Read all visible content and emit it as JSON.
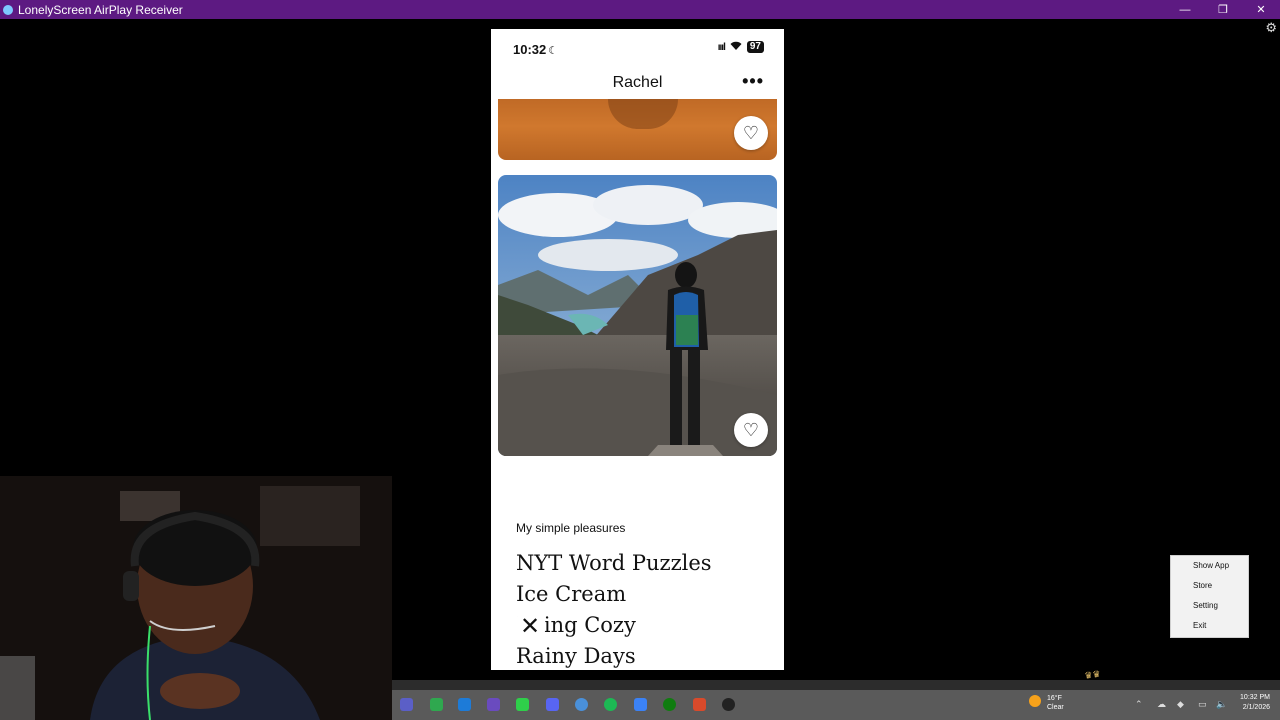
{
  "window": {
    "title": "LonelyScreen AirPlay Receiver",
    "controls": {
      "minimize": "—",
      "restore": "❐",
      "close": "✕"
    },
    "settings_icon": "gear-icon"
  },
  "phone": {
    "status": {
      "time": "10:32",
      "battery": "97",
      "moon": "☾",
      "signal": "ıııl",
      "wifi": "⌔"
    },
    "header": {
      "name": "Rachel",
      "more": "•••"
    },
    "photos": [
      {
        "description_icon": "heart-icon"
      },
      {
        "description_icon": "heart-icon"
      }
    ],
    "prompt_card": {
      "prompt": "My simple pleasures",
      "answers": [
        "NYT Word Puzzles",
        "Ice Cream",
        "Being Cozy",
        "Rainy Days"
      ]
    },
    "close_icon": "✕"
  },
  "tray_menu": {
    "items": [
      "Show App",
      "Store",
      "Setting",
      "Exit"
    ]
  },
  "taskbar": {
    "weather": {
      "temp": "16°F",
      "condition": "Clear"
    },
    "clock": {
      "time": "10:32 PM",
      "date": "2/1/2026"
    }
  },
  "heart_glyph": "♡"
}
